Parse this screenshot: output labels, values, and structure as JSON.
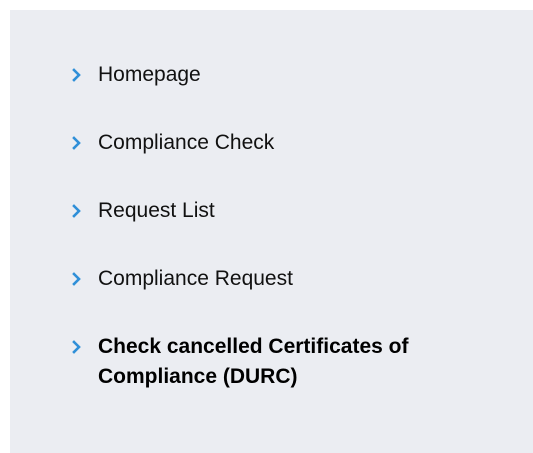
{
  "nav": {
    "accent_color": "#2f8fd8",
    "icon": "chevron-right-icon",
    "items": [
      {
        "label": "Homepage",
        "active": false
      },
      {
        "label": "Compliance Check",
        "active": false
      },
      {
        "label": "Request List",
        "active": false
      },
      {
        "label": "Compliance Request",
        "active": false
      },
      {
        "label": "Check cancelled Certificates of Compliance (DURC)",
        "active": true
      }
    ]
  }
}
